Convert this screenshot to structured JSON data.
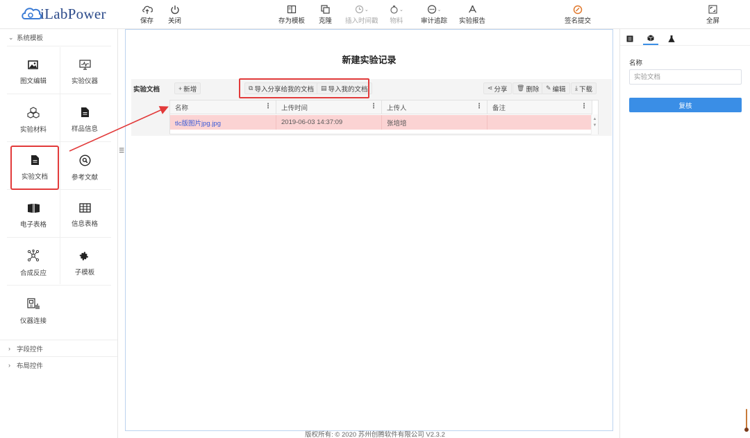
{
  "app": {
    "logo_text": "iLabPower"
  },
  "toolbar": {
    "save": "保存",
    "close": "关闭",
    "save_template": "存为模板",
    "clone": "克隆",
    "insert_timestamp": "插入时间戳",
    "materials": "物料",
    "audit_trail": "审计追踪",
    "report": "实验报告",
    "sign_submit": "签名提交",
    "fullscreen": "全屏",
    "sign_color": "#e0782c"
  },
  "left_panel": {
    "system_templates": "系统模板",
    "tiles": [
      {
        "label": "图文编辑",
        "icon": "image-text-icon"
      },
      {
        "label": "实验仪器",
        "icon": "instrument-monitor-icon"
      },
      {
        "label": "实验材料",
        "icon": "materials-cubes-icon"
      },
      {
        "label": "样品信息",
        "icon": "sample-document-icon"
      },
      {
        "label": "实验文档",
        "icon": "document-icon",
        "selected": true
      },
      {
        "label": "参考文献",
        "icon": "reference-search-icon"
      },
      {
        "label": "电子表格",
        "icon": "spreadsheet-book-icon"
      },
      {
        "label": "信息表格",
        "icon": "table-grid-icon"
      },
      {
        "label": "合成反应",
        "icon": "molecule-icon"
      },
      {
        "label": "子模板",
        "icon": "puzzle-icon"
      },
      {
        "label": "仪器连接",
        "icon": "instrument-link-icon"
      }
    ],
    "field_controls": "字段控件",
    "layout_controls": "布局控件",
    "highlight_color": "#e23a3a"
  },
  "canvas": {
    "title": "新建实验记录",
    "doc_label": "实验文档",
    "buttons": {
      "add": "新增",
      "import_shared": "导入分享给我的文档",
      "import_mine": "导入我的文档",
      "share": "分享",
      "delete": "删除",
      "edit": "编辑",
      "download": "下载"
    },
    "table": {
      "columns": [
        "名称",
        "上传时间",
        "上传人",
        "备注"
      ],
      "rows": [
        {
          "name": "tlc版图片jpg.jpg",
          "time": "2019-06-03 14:37:09",
          "uploader": "张培培",
          "note": ""
        }
      ],
      "row_highlight": "#fbd3d3"
    }
  },
  "footer": {
    "text": "版权所有: © 2020 苏州创腾软件有限公司   V2.3.2"
  },
  "right_panel": {
    "tabs": [
      "info-tab",
      "package-tab",
      "flask-tab"
    ],
    "name_label": "名称",
    "name_placeholder": "实验文档",
    "review_button": "复核",
    "accent_color": "#3a8ee6"
  }
}
